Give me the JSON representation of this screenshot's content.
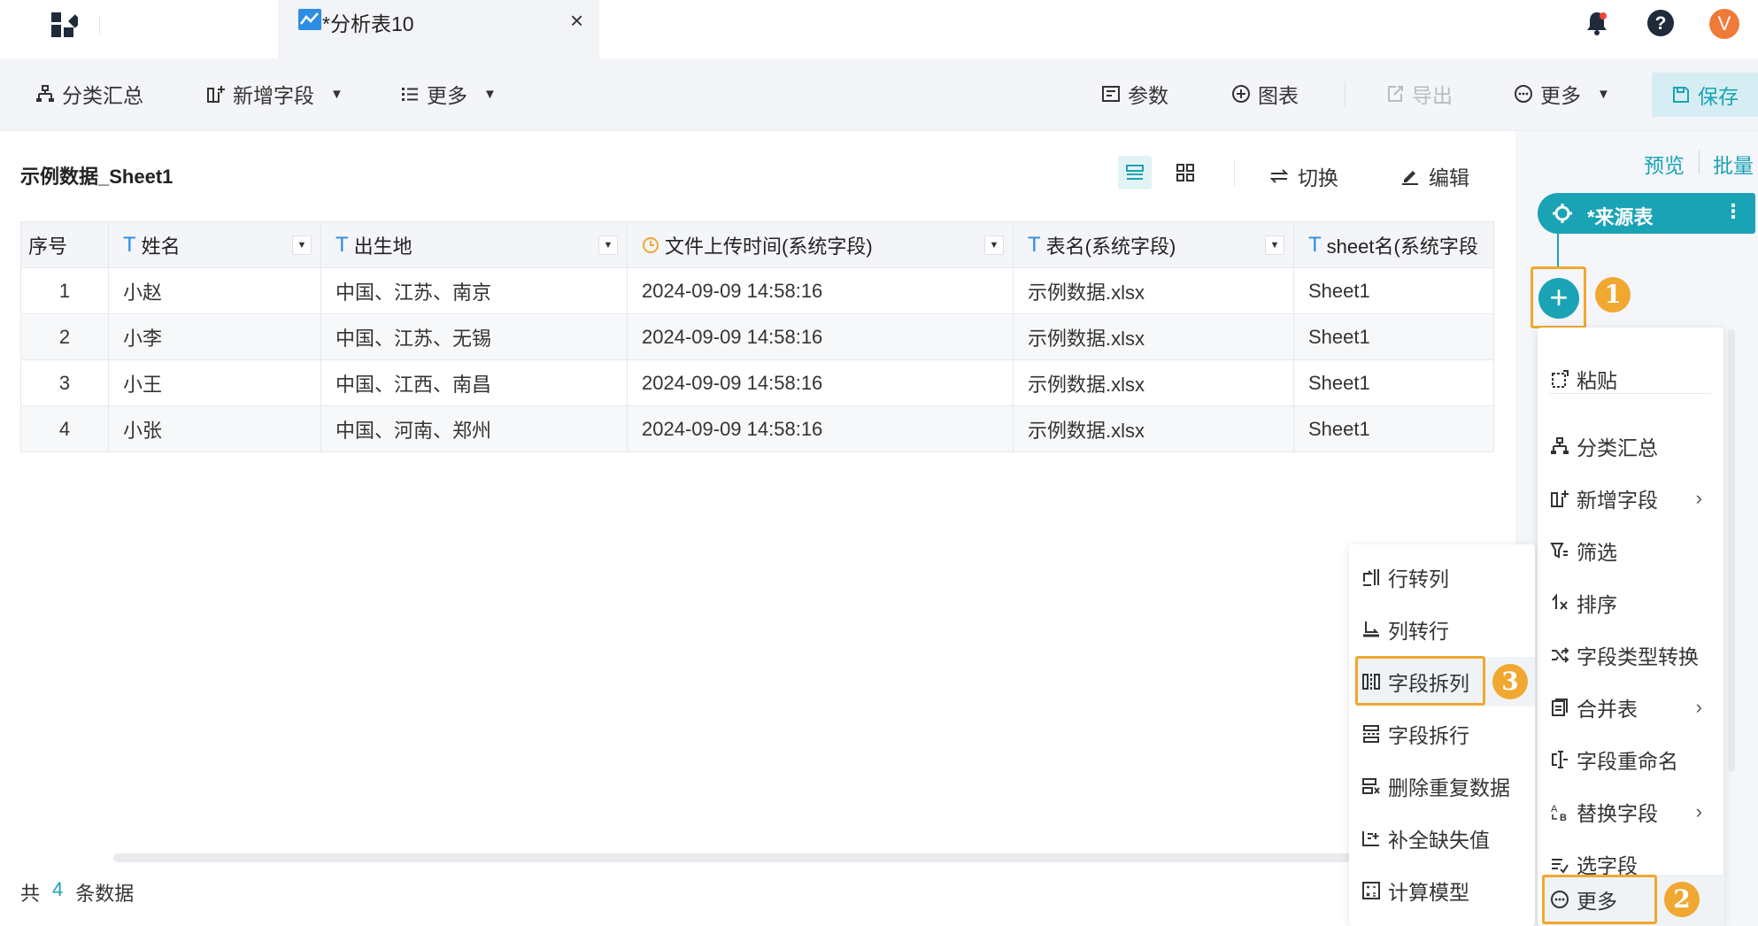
{
  "topbar": {
    "tab_title": "*分析表10",
    "tab_close": "×",
    "avatar_letter": "V"
  },
  "toolbar": {
    "group_summary": "分类汇总",
    "add_field": "新增字段",
    "more_left": "更多",
    "params": "参数",
    "chart": "图表",
    "export": "导出",
    "more_right": "更多",
    "save": "保存"
  },
  "sheet": {
    "title": "示例数据_Sheet1",
    "switch": "切换",
    "edit": "编辑",
    "columns": [
      {
        "label": "序号",
        "type": "none"
      },
      {
        "label": "姓名",
        "type": "text"
      },
      {
        "label": "出生地",
        "type": "text"
      },
      {
        "label": "文件上传时间(系统字段)",
        "type": "time"
      },
      {
        "label": "表名(系统字段)",
        "type": "text"
      },
      {
        "label": "sheet名(系统字段",
        "type": "text"
      }
    ],
    "type_glyph": "T",
    "rows": [
      [
        "1",
        "小赵",
        "中国、江苏、南京",
        "2024-09-09 14:58:16",
        "示例数据.xlsx",
        "Sheet1"
      ],
      [
        "2",
        "小李",
        "中国、江苏、无锡",
        "2024-09-09 14:58:16",
        "示例数据.xlsx",
        "Sheet1"
      ],
      [
        "3",
        "小王",
        "中国、江西、南昌",
        "2024-09-09 14:58:16",
        "示例数据.xlsx",
        "Sheet1"
      ],
      [
        "4",
        "小张",
        "中国、河南、郑州",
        "2024-09-09 14:58:16",
        "示例数据.xlsx",
        "Sheet1"
      ]
    ],
    "footer": {
      "prefix": "共",
      "count": "4",
      "suffix": "条数据"
    }
  },
  "right_panel": {
    "preview": "预览",
    "batch": "批量",
    "node_label": "*来源表",
    "node_more": "⋮",
    "add_symbol": "+",
    "badges": [
      "1",
      "2",
      "3"
    ],
    "menu": [
      {
        "label": "粘贴",
        "icon": "paste-icon",
        "arrow": false
      },
      {
        "label": "分类汇总",
        "icon": "group-icon",
        "arrow": false
      },
      {
        "label": "新增字段",
        "icon": "add-field-icon",
        "arrow": true
      },
      {
        "label": "筛选",
        "icon": "filter-icon",
        "arrow": false
      },
      {
        "label": "排序",
        "icon": "sort-icon",
        "arrow": false
      },
      {
        "label": "字段类型转换",
        "icon": "shuffle-icon",
        "arrow": false
      },
      {
        "label": "合并表",
        "icon": "merge-icon",
        "arrow": true
      },
      {
        "label": "字段重命名",
        "icon": "rename-icon",
        "arrow": false
      },
      {
        "label": "替换字段",
        "icon": "replace-icon",
        "arrow": true
      },
      {
        "label": "选字段",
        "icon": "select-field-icon",
        "arrow": false
      },
      {
        "label": "更多",
        "icon": "more-circle-icon",
        "arrow": false
      }
    ],
    "menu_arrow": "›",
    "submenu": [
      {
        "label": "行转列",
        "icon": "row-to-col-icon"
      },
      {
        "label": "列转行",
        "icon": "col-to-row-icon"
      },
      {
        "label": "字段拆列",
        "icon": "split-col-icon"
      },
      {
        "label": "字段拆行",
        "icon": "split-row-icon"
      },
      {
        "label": "删除重复数据",
        "icon": "dedupe-icon"
      },
      {
        "label": "补全缺失值",
        "icon": "fill-missing-icon"
      },
      {
        "label": "计算模型",
        "icon": "calc-model-icon"
      }
    ]
  },
  "colors": {
    "accent": "#1aa3b5",
    "highlight": "#f0a830",
    "tab_icon": "#2c8de3",
    "clock": "#f0a830",
    "avatar": "#f07a3a",
    "bell": "#1f2a3a"
  }
}
